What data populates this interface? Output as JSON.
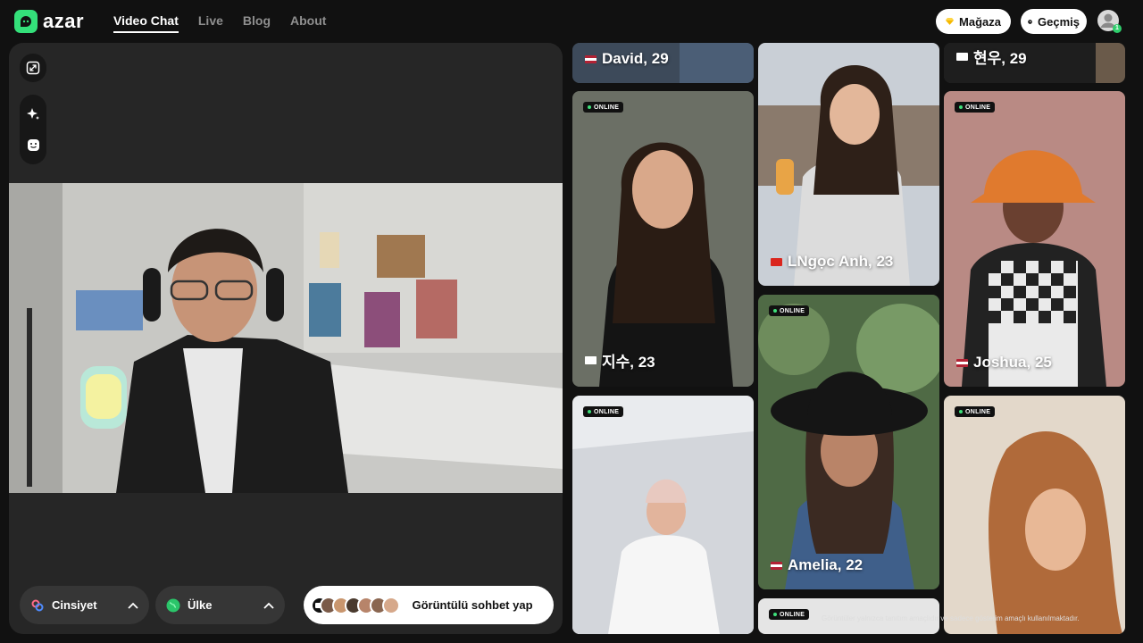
{
  "brand": {
    "name": "azar"
  },
  "nav": {
    "items": [
      {
        "label": "Video Chat",
        "active": true
      },
      {
        "label": "Live",
        "active": false
      },
      {
        "label": "Blog",
        "active": false
      },
      {
        "label": "About",
        "active": false
      }
    ]
  },
  "header": {
    "store_label": "Mağaza",
    "history_label": "Geçmiş",
    "profile_badge": "1"
  },
  "left_panel": {
    "gender_label": "Cinsiyet",
    "country_label": "Ülke",
    "start_label": "Görüntülü sohbet yap"
  },
  "cards": [
    {
      "name": "David, 29",
      "country": "US",
      "online": false
    },
    {
      "name": "현우, 29",
      "country": "KR",
      "online": false
    },
    {
      "name": "지수, 23",
      "country": "KR",
      "online": true
    },
    {
      "name": "LNgọc Anh, 23",
      "country": "VN",
      "online": false
    },
    {
      "name": "Joshua, 25",
      "country": "US",
      "online": true
    },
    {
      "name": "",
      "country": "",
      "online": true
    },
    {
      "name": "Amelia, 22",
      "country": "US",
      "online": true
    },
    {
      "name": "",
      "country": "",
      "online": true
    },
    {
      "name": "",
      "country": "",
      "online": true
    }
  ],
  "online_label": "ONLINE",
  "disclaimer": "Görüntüler yalnızca tanıtım amaçlıdır ve sadece gösterim amaçlı kullanılmaktadır.",
  "colors": {
    "brand_green": "#34e07a",
    "panel_bg": "#262626",
    "page_bg": "#111111"
  }
}
